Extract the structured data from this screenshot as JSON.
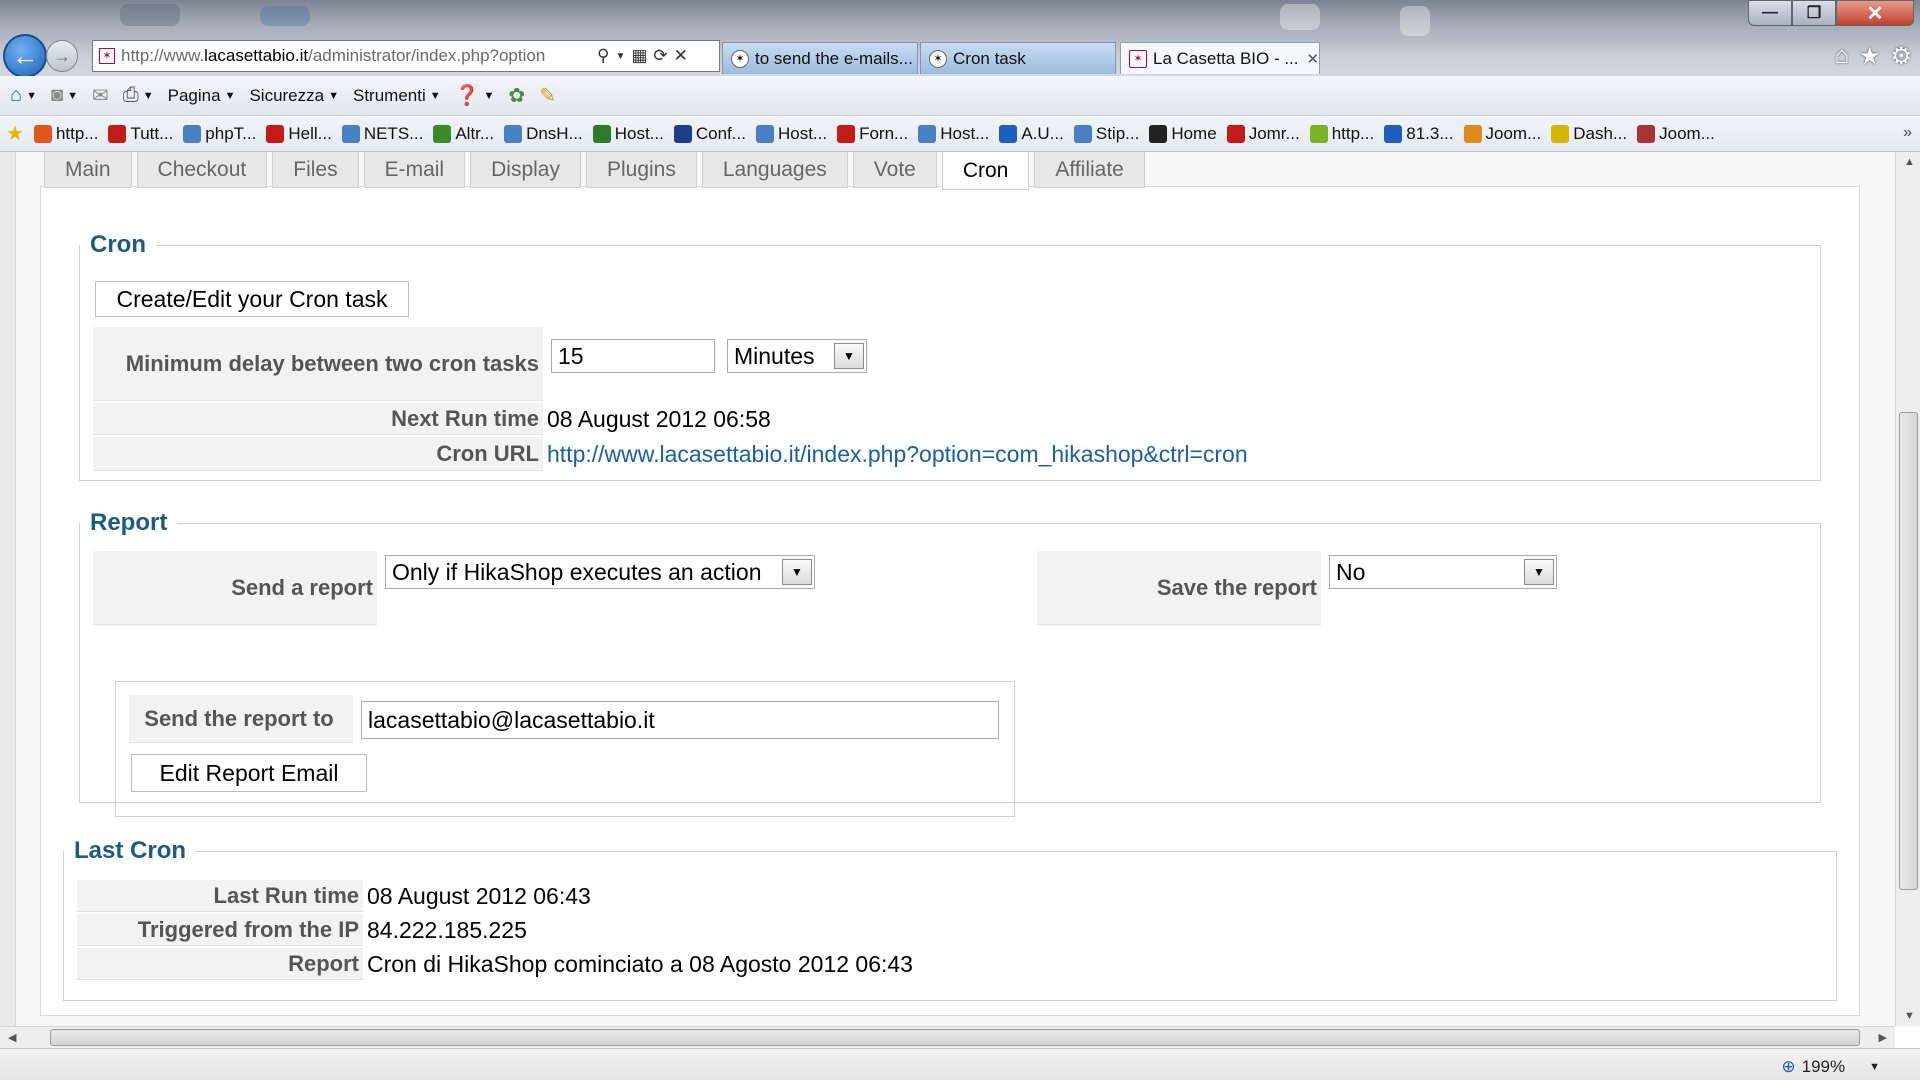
{
  "browser": {
    "address_url_prefix": "http://www.",
    "address_url_domain": "lacasettabio.it",
    "address_url_path": "/administrator/index.php?option",
    "tabs": [
      {
        "label": "to send the e-mails...",
        "active": false
      },
      {
        "label": "Cron task",
        "active": false
      },
      {
        "label": "La Casetta BIO - ...",
        "active": true
      }
    ],
    "window_controls": {
      "minimize": "—",
      "restore": "❐",
      "close": "✕"
    }
  },
  "commandbar": {
    "items": [
      {
        "label": "Pagina"
      },
      {
        "label": "Sicurezza"
      },
      {
        "label": "Strumenti"
      }
    ]
  },
  "favorites": [
    {
      "label": "http...",
      "color": "#e2571e",
      "icon": "blogger-icon"
    },
    {
      "label": "Tutt...",
      "color": "#c41a1a",
      "icon": "news-icon"
    },
    {
      "label": "phpT...",
      "color": "#4a7fc4",
      "icon": "ie-page-icon"
    },
    {
      "label": "Hell...",
      "color": "#c41a1a",
      "icon": "flag-icon"
    },
    {
      "label": "NETS...",
      "color": "#4a7fc4",
      "icon": "ie-page-icon"
    },
    {
      "label": "Altr...",
      "color": "#3a8a2a",
      "icon": "group-icon"
    },
    {
      "label": "DnsH...",
      "color": "#4a7fc4",
      "icon": "ie-page-icon"
    },
    {
      "label": "Host...",
      "color": "#2d7a2d",
      "icon": "p-icon"
    },
    {
      "label": "Conf...",
      "color": "#1d3f8a",
      "icon": "h-icon"
    },
    {
      "label": "Host...",
      "color": "#4a7fc4",
      "icon": "ie-page-icon"
    },
    {
      "label": "Forn...",
      "color": "#c41a1a",
      "icon": "fs-icon"
    },
    {
      "label": "Host...",
      "color": "#4a7fc4",
      "icon": "ie-page-icon"
    },
    {
      "label": "A.U...",
      "color": "#1d5fbf",
      "icon": "house-icon"
    },
    {
      "label": "Stip...",
      "color": "#4a7fc4",
      "icon": "ie-page-icon"
    },
    {
      "label": "Home",
      "color": "#222222",
      "icon": "joomla-icon"
    },
    {
      "label": "Jomr...",
      "color": "#c41a1a",
      "icon": "joomla-icon"
    },
    {
      "label": "http...",
      "color": "#7bb324",
      "icon": "cg-icon"
    },
    {
      "label": "81.3...",
      "color": "#1d5fbf",
      "icon": "circle-icon"
    },
    {
      "label": "Joom...",
      "color": "#e08a1e",
      "icon": "joomla-icon"
    },
    {
      "label": "Dash...",
      "color": "#d6b400",
      "icon": "p-icon"
    },
    {
      "label": "Joom...",
      "color": "#a33",
      "icon": "jp-icon"
    }
  ],
  "config_tabs": [
    {
      "label": "Main",
      "active": false
    },
    {
      "label": "Checkout",
      "active": false
    },
    {
      "label": "Files",
      "active": false
    },
    {
      "label": "E-mail",
      "active": false
    },
    {
      "label": "Display",
      "active": false
    },
    {
      "label": "Plugins",
      "active": false
    },
    {
      "label": "Languages",
      "active": false
    },
    {
      "label": "Vote",
      "active": false
    },
    {
      "label": "Cron",
      "active": true
    },
    {
      "label": "Affiliate",
      "active": false
    }
  ],
  "cron": {
    "legend": "Cron",
    "edit_button": "Create/Edit your Cron task",
    "min_delay_label": "Minimum delay between two cron tasks",
    "min_delay_value": "15",
    "min_delay_unit": "Minutes",
    "next_run_label": "Next Run time",
    "next_run_value": "08 August 2012 06:58",
    "cron_url_label": "Cron URL",
    "cron_url_value": "http://www.lacasettabio.it/index.php?option=com_hikashop&ctrl=cron"
  },
  "report": {
    "legend": "Report",
    "send_label": "Send a report",
    "send_value": "Only if HikaShop executes an action",
    "save_label": "Save the report",
    "save_value": "No",
    "send_to_label": "Send the report to",
    "send_to_value": "lacasettabio@lacasettabio.it",
    "edit_email_button": "Edit Report Email"
  },
  "last_cron": {
    "legend": "Last Cron",
    "last_run_label": "Last Run time",
    "last_run_value": "08 August 2012 06:43",
    "ip_label": "Triggered from the IP",
    "ip_value": "84.222.185.225",
    "report_label": "Report",
    "report_value": "Cron di HikaShop cominciato a 08 Agosto 2012 06:43"
  },
  "status": {
    "zoom": "199%"
  },
  "colors": {
    "legend": "#1b5b86",
    "link": "#1a5fa6"
  }
}
